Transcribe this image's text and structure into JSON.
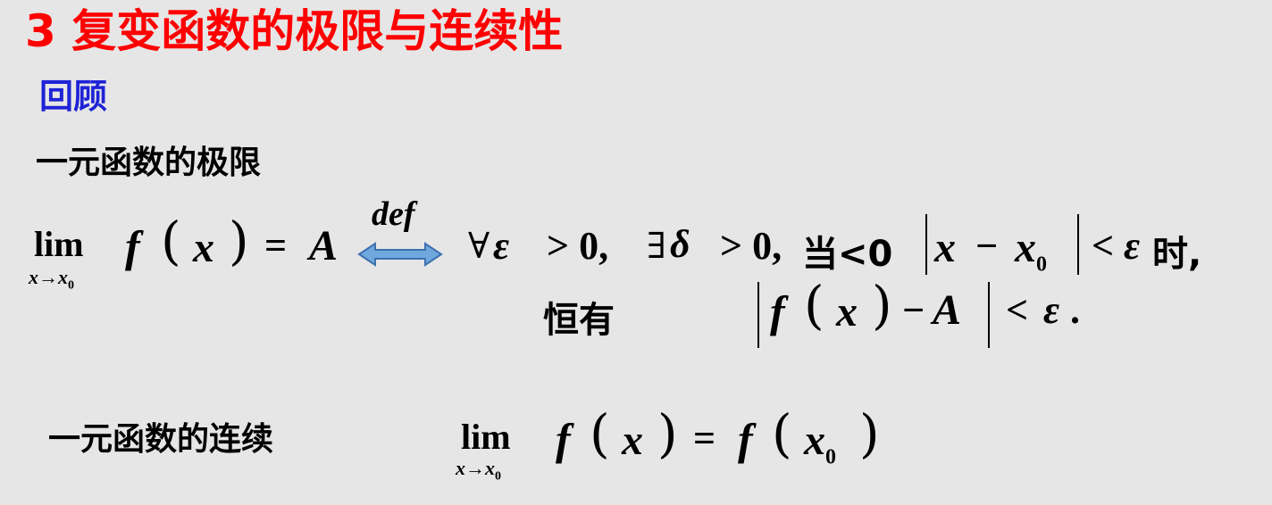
{
  "title": "3 复变函数的极限与连续性",
  "review_label": "回顾",
  "limit_section": {
    "heading": "一元函数的极限",
    "lim": "lim",
    "lim_sub_var": "x→x",
    "lim_sub_index": "0",
    "lhs_func": "f",
    "lhs_var": "x",
    "equals": "=",
    "lhs_value": "A",
    "def_label": "def",
    "forall": "∀",
    "epsilon": "ε",
    "gt_zero": "> 0,",
    "exists": "∃",
    "delta": "δ",
    "gt_zero_2": "> 0,",
    "when": "当<0",
    "x": "x",
    "minus": "−",
    "x0": "x",
    "x0_index": "0",
    "lt": "<",
    "epsilon_2": "ε",
    "time_suffix": "时,",
    "always_has": "恒有",
    "ineq_f": "f",
    "ineq_x": "x",
    "ineq_minus": "−",
    "ineq_A": "A",
    "ineq_lt": "<",
    "ineq_epsilon": "ε",
    "ineq_end": "."
  },
  "continuity_section": {
    "heading": "一元函数的连续",
    "lim": "lim",
    "lim_sub_var": "x→x",
    "lim_sub_index": "0",
    "lhs_func": "f",
    "lhs_var": "x",
    "equals": "=",
    "rhs_func": "f",
    "rhs_var": "x",
    "rhs_index": "0"
  },
  "colors": {
    "background": "#e6e6e6",
    "title": "#ff0000",
    "review": "#1f23d6",
    "arrow_fill": "#6fa8dc",
    "arrow_stroke": "#3d6fb0"
  },
  "icons": {
    "equivalence_arrow": "double-headed-arrow"
  }
}
